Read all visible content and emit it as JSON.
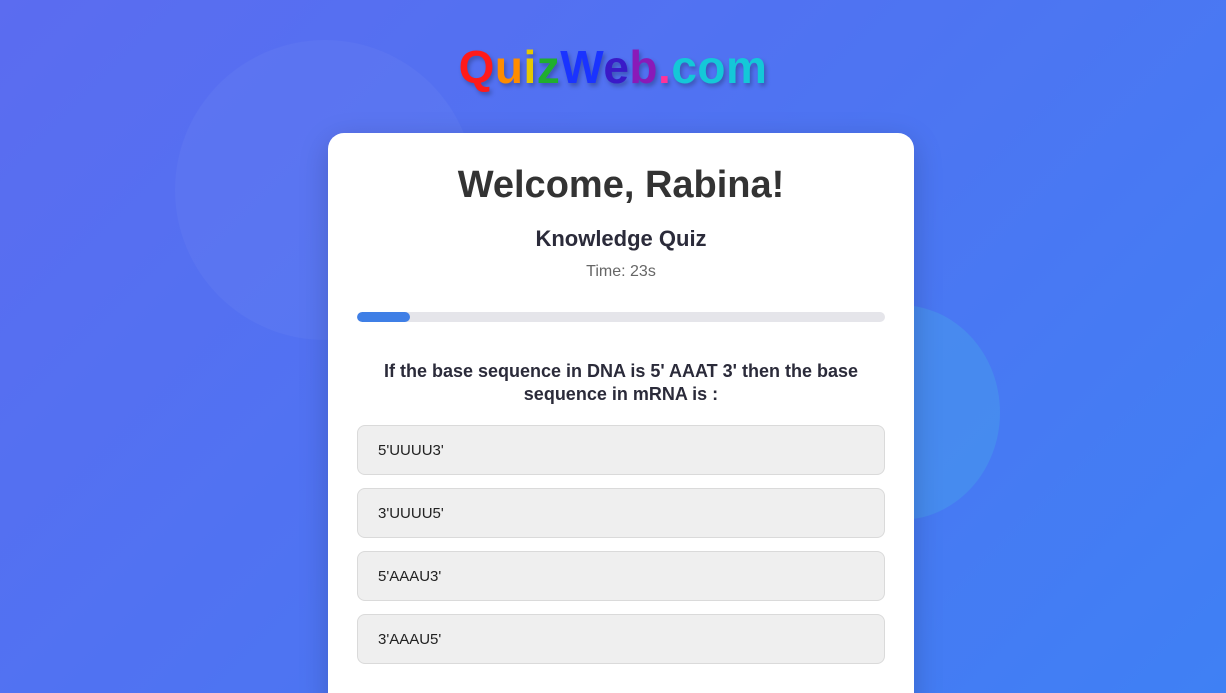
{
  "brand": {
    "logo_letters": [
      {
        "char": "Q",
        "color": "#ff1a1a"
      },
      {
        "char": "u",
        "color": "#ff8c00"
      },
      {
        "char": "i",
        "color": "#e6c800"
      },
      {
        "char": "z",
        "color": "#1fae2e"
      },
      {
        "char": "W",
        "color": "#1a33ff"
      },
      {
        "char": "e",
        "color": "#3a1ac8"
      },
      {
        "char": "b",
        "color": "#8a1ab8"
      },
      {
        "char": ".",
        "color": "#ff3399"
      },
      {
        "char": "c",
        "color": "#14c8d8"
      },
      {
        "char": "o",
        "color": "#14c8d8"
      },
      {
        "char": "m",
        "color": "#14c8d8"
      }
    ]
  },
  "header": {
    "welcome": "Welcome, Rabina!",
    "quiz_title": "Knowledge Quiz",
    "timer": "Time: 23s"
  },
  "progress": {
    "fraction": 0.1,
    "color": "#3f7fe6"
  },
  "question": {
    "text": "If the base sequence in DNA is 5' AAAT 3' then the base sequence in mRNA is :"
  },
  "options": [
    {
      "label": "5'UUUU3'"
    },
    {
      "label": "3'UUUU5'"
    },
    {
      "label": "5'AAAU3'"
    },
    {
      "label": "3'AAAU5'"
    }
  ]
}
